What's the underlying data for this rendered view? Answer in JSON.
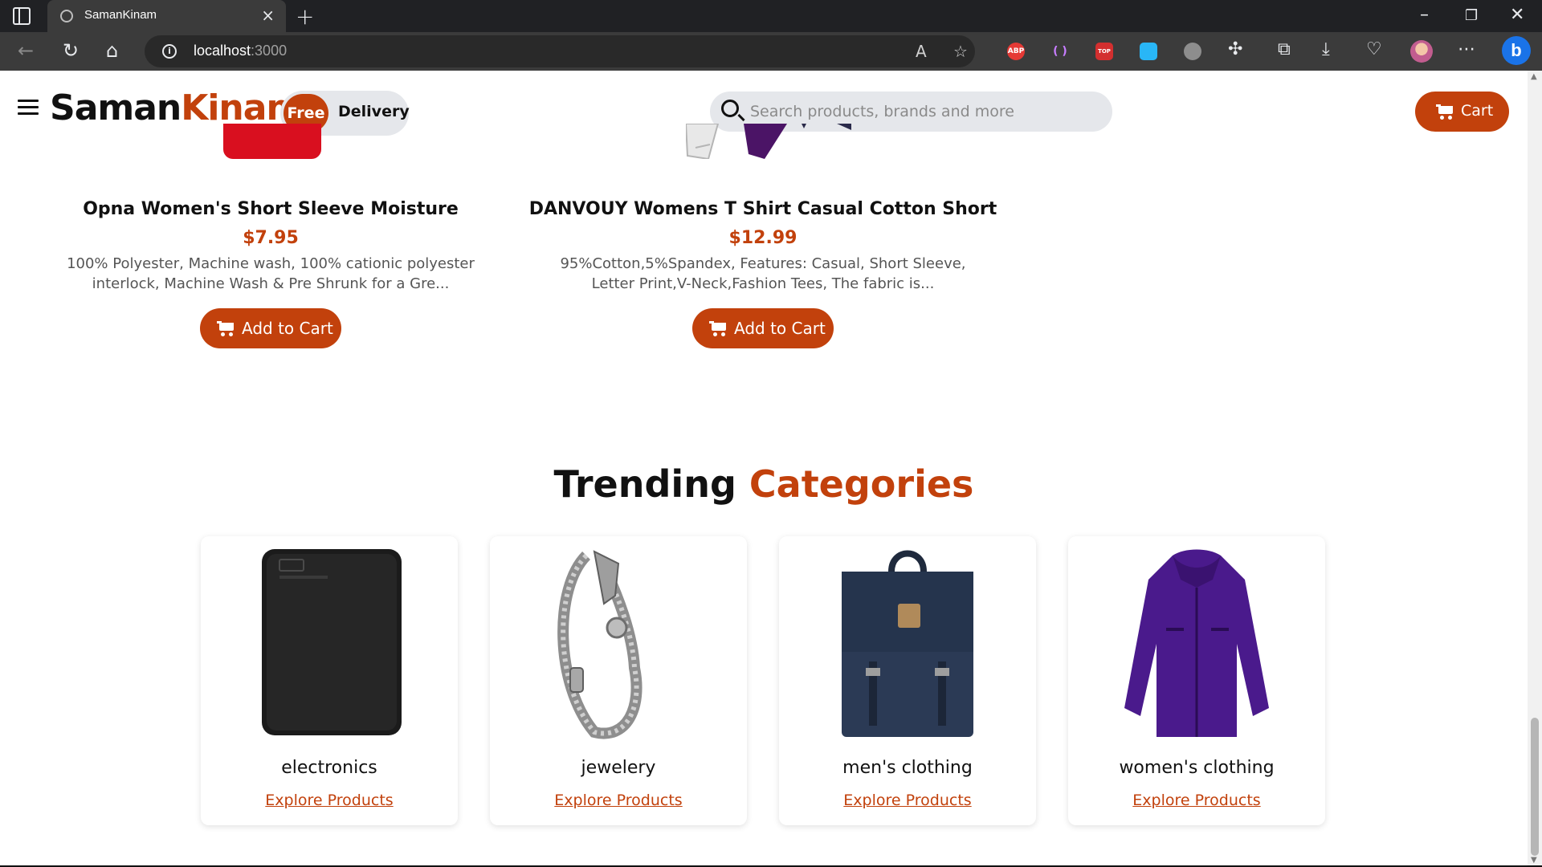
{
  "browser": {
    "tab_title": "SamanKinam",
    "url_host": "localhost",
    "url_port": ":3000",
    "extensions": [
      {
        "name": "adblock-plus-icon",
        "label": "ABP",
        "color": "#e53935"
      },
      {
        "name": "extension-purple-icon",
        "label": "( )",
        "color": "#3b3b3b"
      },
      {
        "name": "extension-red-icon",
        "label": "TOP",
        "color": "#d32f2f"
      },
      {
        "name": "save-extension-icon",
        "label": "",
        "color": "#29b6f6"
      },
      {
        "name": "extension-mask-icon",
        "label": "",
        "color": "#8d8d8d"
      }
    ]
  },
  "header": {
    "brand_part1": "Saman",
    "brand_part2": "Kinam",
    "badge_free": "Free",
    "badge_delivery": "Delivery",
    "search_placeholder": "Search products, brands and more",
    "cart_label": "Cart"
  },
  "products": [
    {
      "title": "Opna Women's Short Sleeve Moisture",
      "price": "$7.95",
      "description": "100% Polyester, Machine wash, 100% cationic polyester interlock, Machine Wash & Pre Shrunk for a Gre...",
      "button": "Add to Cart"
    },
    {
      "title": "DANVOUY Womens T Shirt Casual Cotton Short",
      "price": "$12.99",
      "description": "95%Cotton,5%Spandex, Features: Casual, Short Sleeve, Letter Print,V-Neck,Fashion Tees, The fabric is...",
      "button": "Add to Cart"
    }
  ],
  "trending": {
    "title_part1": "Trending",
    "title_part2": "Categories",
    "categories": [
      {
        "name": "electronics",
        "link": "Explore Products"
      },
      {
        "name": "jewelery",
        "link": "Explore Products"
      },
      {
        "name": "men's clothing",
        "link": "Explore Products"
      },
      {
        "name": "women's clothing",
        "link": "Explore Products"
      }
    ]
  },
  "colors": {
    "accent": "#c2410c",
    "chrome": "#202124",
    "toolbar": "#3b3b3b"
  }
}
